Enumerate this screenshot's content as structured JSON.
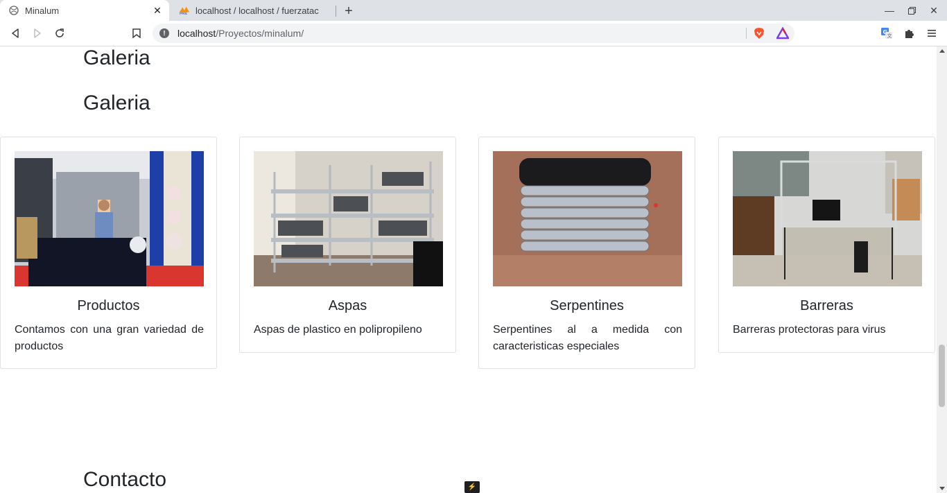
{
  "browser": {
    "tabs": [
      {
        "title": "Minalum",
        "active": true
      },
      {
        "title": "localhost / localhost / fuerzatac",
        "active": false
      }
    ],
    "url_host": "localhost",
    "url_path": "/Proyectos/minalum/"
  },
  "page": {
    "heading_top": "Galeria",
    "heading_gallery": "Galeria",
    "heading_contact": "Contacto",
    "cards": [
      {
        "title": "Productos",
        "text": "Contamos con una gran variedad de productos"
      },
      {
        "title": "Aspas",
        "text": "Aspas de plastico en polipropileno"
      },
      {
        "title": "Serpentines",
        "text": "Serpentines al a medida con caracteristicas especiales"
      },
      {
        "title": "Barreras",
        "text": "Barreras protectoras para virus"
      }
    ]
  },
  "colors": {
    "tabstrip": "#dee1e6",
    "text": "#212529",
    "card_border": "#dee2e6"
  }
}
